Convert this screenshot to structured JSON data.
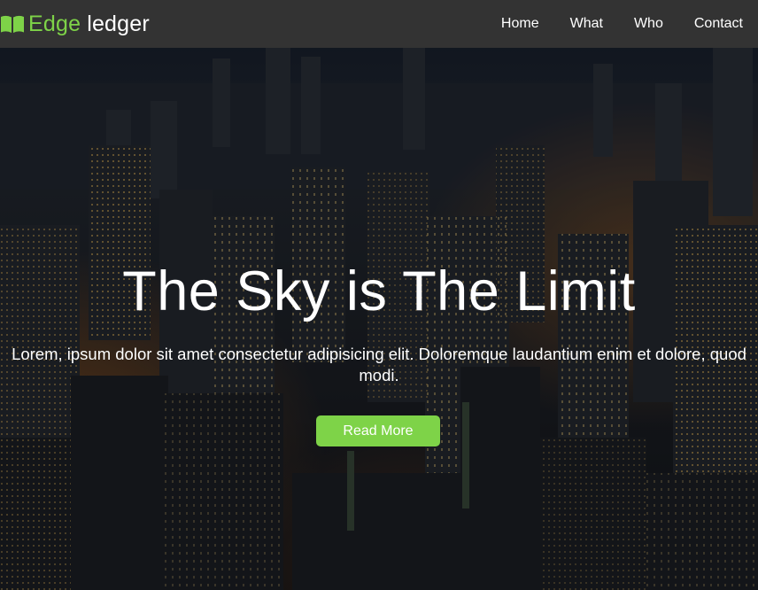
{
  "navbar": {
    "brand_accent": "Edge",
    "brand_rest": "ledger",
    "brand_icon": "book-icon",
    "links": [
      {
        "label": "Home"
      },
      {
        "label": "What"
      },
      {
        "label": "Who"
      },
      {
        "label": "Contact"
      }
    ]
  },
  "hero": {
    "title": "The Sky is The Limit",
    "text": "Lorem, ipsum dolor sit amet consectetur adipisicing elit. Doloremque laudantium enim et dolore, quod modi.",
    "button_label": "Read More",
    "background_image": "night-city-skyline"
  },
  "colors": {
    "accent": "#7ed348",
    "navbar_bg": "#333333",
    "text": "#ffffff"
  }
}
